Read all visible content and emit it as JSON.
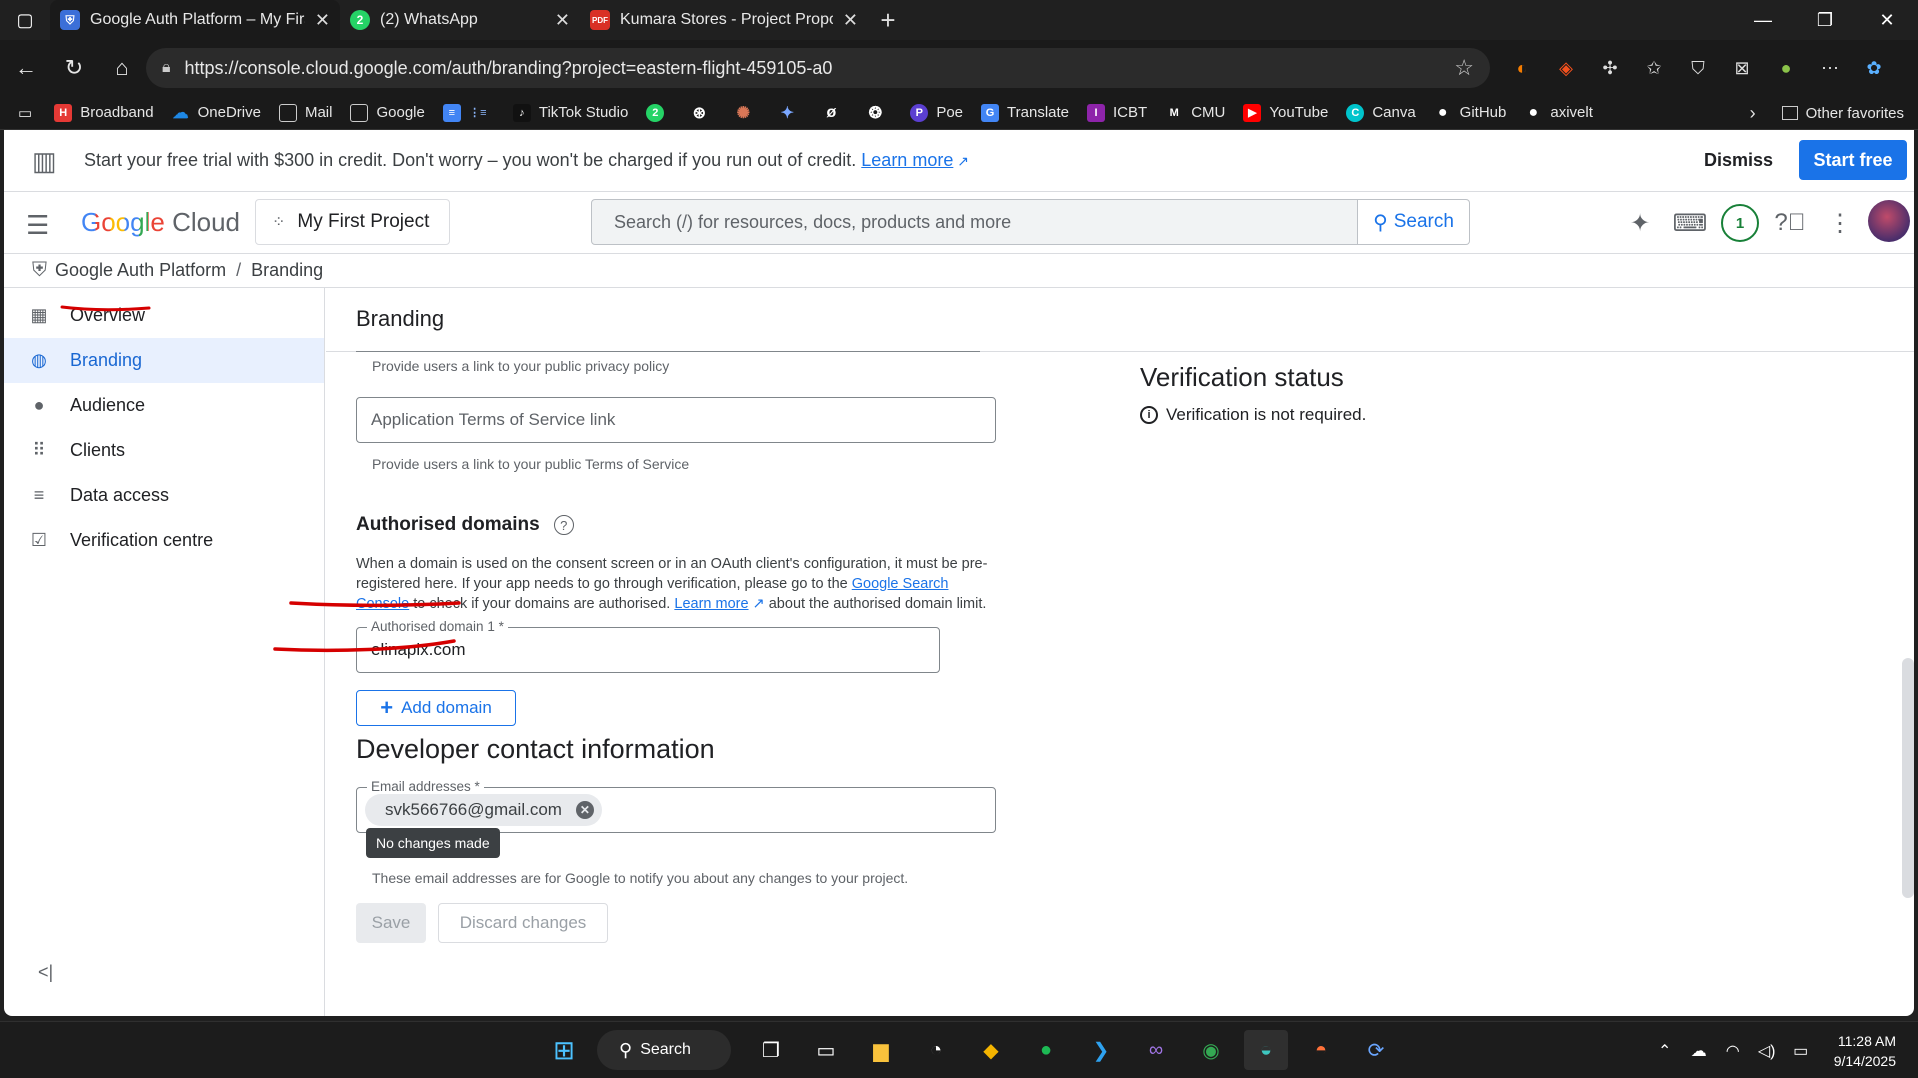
{
  "browser": {
    "tabs": [
      {
        "title": "Google Auth Platform – My First P",
        "fav_color": "#3b6fd8",
        "fav_glyph": "⛨",
        "active": true
      },
      {
        "title": "(2) WhatsApp",
        "fav_color": "#25d366",
        "fav_glyph": "2",
        "active": false
      },
      {
        "title": "Kumara Stores - Project Proposal.",
        "fav_color": "#d93025",
        "fav_glyph": "PDF",
        "active": false
      }
    ],
    "url": "https://console.cloud.google.com/auth/branding?project=eastern-flight-459105-a0",
    "bookmarks": [
      {
        "label": "Broadband",
        "color": "#e53935",
        "glyph": "H"
      },
      {
        "label": "OneDrive",
        "color": "#1e88e5",
        "glyph": "☁"
      },
      {
        "label": "Mail",
        "color": "transparent",
        "glyph": "▢"
      },
      {
        "label": "Google",
        "color": "transparent",
        "glyph": "▢"
      },
      {
        "label": "",
        "color": "#4285f4",
        "glyph": "≡"
      },
      {
        "label": "TikTok Studio",
        "color": "#111111",
        "glyph": "♪"
      },
      {
        "label": "",
        "color": "#25d366",
        "glyph": "2"
      },
      {
        "label": "",
        "color": "transparent",
        "glyph": "⊛"
      },
      {
        "label": "",
        "color": "transparent",
        "glyph": "✺"
      },
      {
        "label": "",
        "color": "transparent",
        "glyph": "✦"
      },
      {
        "label": "",
        "color": "transparent",
        "glyph": "ø"
      },
      {
        "label": "",
        "color": "transparent",
        "glyph": "❂"
      },
      {
        "label": "Poe",
        "color": "#5b3fd1",
        "glyph": "P"
      },
      {
        "label": "Translate",
        "color": "#4285f4",
        "glyph": "G"
      },
      {
        "label": "ICBT",
        "color": "#8e24aa",
        "glyph": "I"
      },
      {
        "label": "CMU",
        "color": "transparent",
        "glyph": "M"
      },
      {
        "label": "YouTube",
        "color": "#ff0000",
        "glyph": "▶"
      },
      {
        "label": "Canva",
        "color": "#00c4cc",
        "glyph": "C"
      },
      {
        "label": "GitHub",
        "color": "transparent",
        "glyph": "●"
      },
      {
        "label": "axivelt",
        "color": "transparent",
        "glyph": "●"
      }
    ],
    "other_favorites": "Other favorites"
  },
  "trial": {
    "message": "Start your free trial with $300 in credit. Don't worry – you won't be charged if you run out of credit.",
    "learn_more": "Learn more",
    "dismiss": "Dismiss",
    "start_free": "Start free"
  },
  "topnav": {
    "logo_google": "Google",
    "logo_cloud": "Cloud",
    "project": "My First Project",
    "search_placeholder": "Search (/) for resources, docs, products and more",
    "search_button": "Search",
    "notification_count": "1"
  },
  "breadcrumb": {
    "parent": "Google Auth Platform",
    "separator": "/",
    "current": "Branding"
  },
  "sidebar": {
    "items": [
      {
        "label": "Overview",
        "icon": "dashboard-icon",
        "glyph": "▦",
        "active": false
      },
      {
        "label": "Branding",
        "icon": "palette-icon",
        "glyph": "◍",
        "active": true
      },
      {
        "label": "Audience",
        "icon": "account-icon",
        "glyph": "●",
        "active": false
      },
      {
        "label": "Clients",
        "icon": "grid-icon",
        "glyph": "⠿",
        "active": false
      },
      {
        "label": "Data access",
        "icon": "tune-icon",
        "glyph": "≡",
        "active": false
      },
      {
        "label": "Verification centre",
        "icon": "checkbox-icon",
        "glyph": "☑",
        "active": false
      }
    ]
  },
  "main": {
    "title": "Branding",
    "privacy_hint": "Provide users a link to your public privacy policy",
    "tos_placeholder": "Application Terms of Service link",
    "tos_hint": "Provide users a link to your public Terms of Service",
    "domains_title": "Authorised domains",
    "domains_desc_1": "When a domain is used on the consent screen or in an OAuth client's configuration, it must be pre-registered here. If your app needs to go through verification, please go to the ",
    "domains_desc_link1": "Google Search Console",
    "domains_desc_2": " to check if your domains are authorised. ",
    "domains_desc_link2": "Learn more",
    "domains_desc_3": " about the authorised domain limit.",
    "domain_label": "Authorised domain 1 *",
    "domain_value": "elinapix.com",
    "add_domain": "Add domain",
    "dev_title": "Developer contact information",
    "email_label": "Email addresses *",
    "email_chip": "svk566766@gmail.com",
    "email_hint": "These email addresses are for Google to notify you about any changes to your project.",
    "tooltip": "No changes made",
    "save": "Save",
    "discard": "Discard changes"
  },
  "verification": {
    "title": "Verification status",
    "note": "Verification is not required."
  },
  "taskbar": {
    "search": "Search",
    "time": "11:28 AM",
    "date": "9/14/2025"
  },
  "colors": {
    "accent": "#1a73e8",
    "annotation": "#d50000"
  }
}
